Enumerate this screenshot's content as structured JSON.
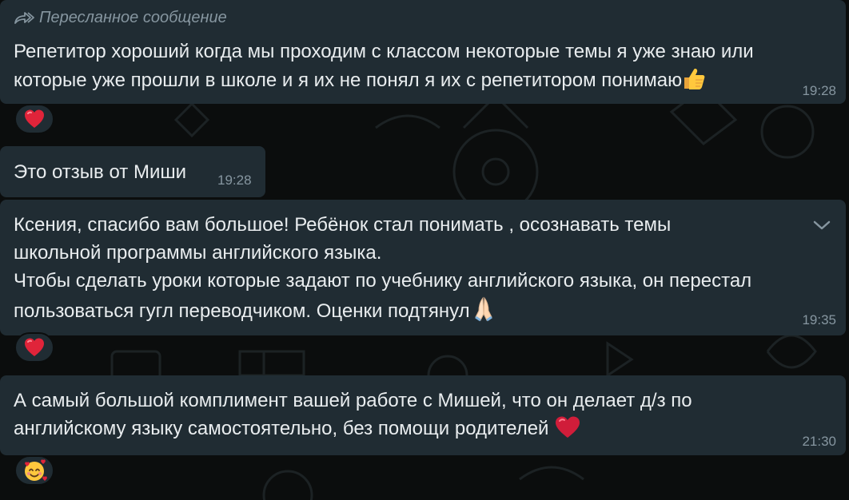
{
  "messages": [
    {
      "forwarded_label": "Пересланное сообщение",
      "lines": [
        "Репетитор хороший когда мы проходим с классом некоторые темы я уже знаю или",
        "которые уже прошли в школе и я их не понял я их с репетитором понимаю"
      ],
      "trailing_emoji": "thumbs-up",
      "time": "19:28",
      "reaction": "red-heart"
    },
    {
      "lines": [
        "Это отзыв от Миши"
      ],
      "time": "19:28"
    },
    {
      "lines": [
        "Ксения,  спасибо вам большое! Ребёнок стал понимать , осознавать темы",
        "школьной программы английского языка.",
        "Чтобы сделать уроки которые задают по учебнику английского языка,  он перестал",
        "пользоваться гугл переводчиком.  Оценки подтянул"
      ],
      "trailing_emoji": "folded-hands",
      "time": "19:35",
      "has_menu_chevron": true,
      "reaction": "red-heart"
    },
    {
      "lines": [
        "А самый большой комплимент вашей работе с Мишей,  что он делает д/з по",
        "английскому языку  самостоятельно,  без помощи родителей"
      ],
      "trailing_emoji": "red-heart",
      "time": "21:30",
      "reaction": "smiling-face-with-hearts"
    }
  ],
  "colors": {
    "background": "#0b0d0d",
    "bubble": "#202c33",
    "text": "#e9edef",
    "meta": "#8696a0",
    "heart": "#e0243a"
  }
}
